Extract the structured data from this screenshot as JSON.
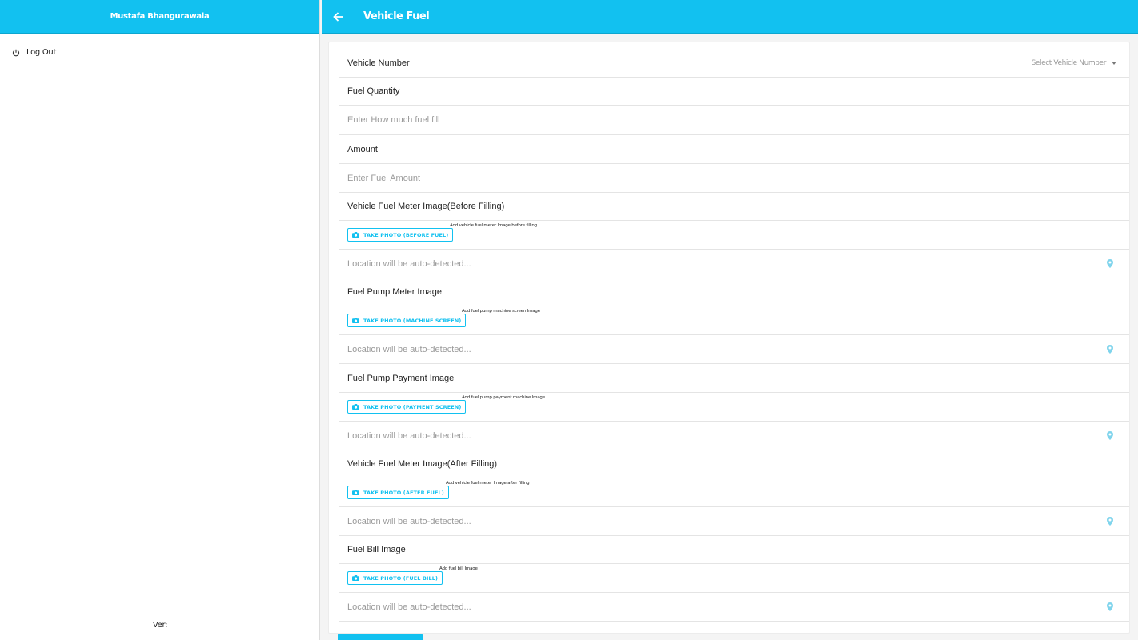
{
  "sidebar": {
    "user_name": "Mustafa Bhangurawala",
    "logout_label": "Log Out",
    "version_label": "Ver:"
  },
  "header": {
    "title": "Vehicle Fuel"
  },
  "form": {
    "vehicle_number_label": "Vehicle Number",
    "vehicle_number_select": "Select Vehicle Number",
    "fuel_quantity_label": "Fuel Quantity",
    "fuel_quantity_placeholder": "Enter How much fuel fill",
    "amount_label": "Amount",
    "amount_placeholder": "Enter Fuel Amount",
    "sections": [
      {
        "label": "Vehicle Fuel Meter Image(Before Filling)",
        "button": "TAKE PHOTO (BEFORE FUEL)",
        "hint": "Add vehicle fuel meter Image before filling",
        "location": "Location will be auto-detected..."
      },
      {
        "label": "Fuel Pump Meter Image",
        "button": "TAKE PHOTO (MACHINE SCREEN)",
        "hint": "Add fuel pump machine screen Image",
        "location": "Location will be auto-detected..."
      },
      {
        "label": "Fuel Pump Payment Image",
        "button": "TAKE PHOTO (PAYMENT SCREEN)",
        "hint": "Add fuel pump payment machine Image",
        "location": "Location will be auto-detected..."
      },
      {
        "label": "Vehicle Fuel Meter Image(After Filling)",
        "button": "TAKE PHOTO (AFTER FUEL)",
        "hint": "Add vehicle fuel meter Image after filling",
        "location": "Location will be auto-detected..."
      },
      {
        "label": "Fuel Bill Image",
        "button": "TAKE PHOTO (FUEL BILL)",
        "hint": "Add fuel bill Image",
        "location": "Location will be auto-detected..."
      }
    ]
  },
  "icons": {
    "power": "power-icon",
    "back": "arrow-left-icon",
    "camera": "camera-icon",
    "location": "map-pin-icon"
  },
  "colors": {
    "accent": "#12c1f0"
  }
}
